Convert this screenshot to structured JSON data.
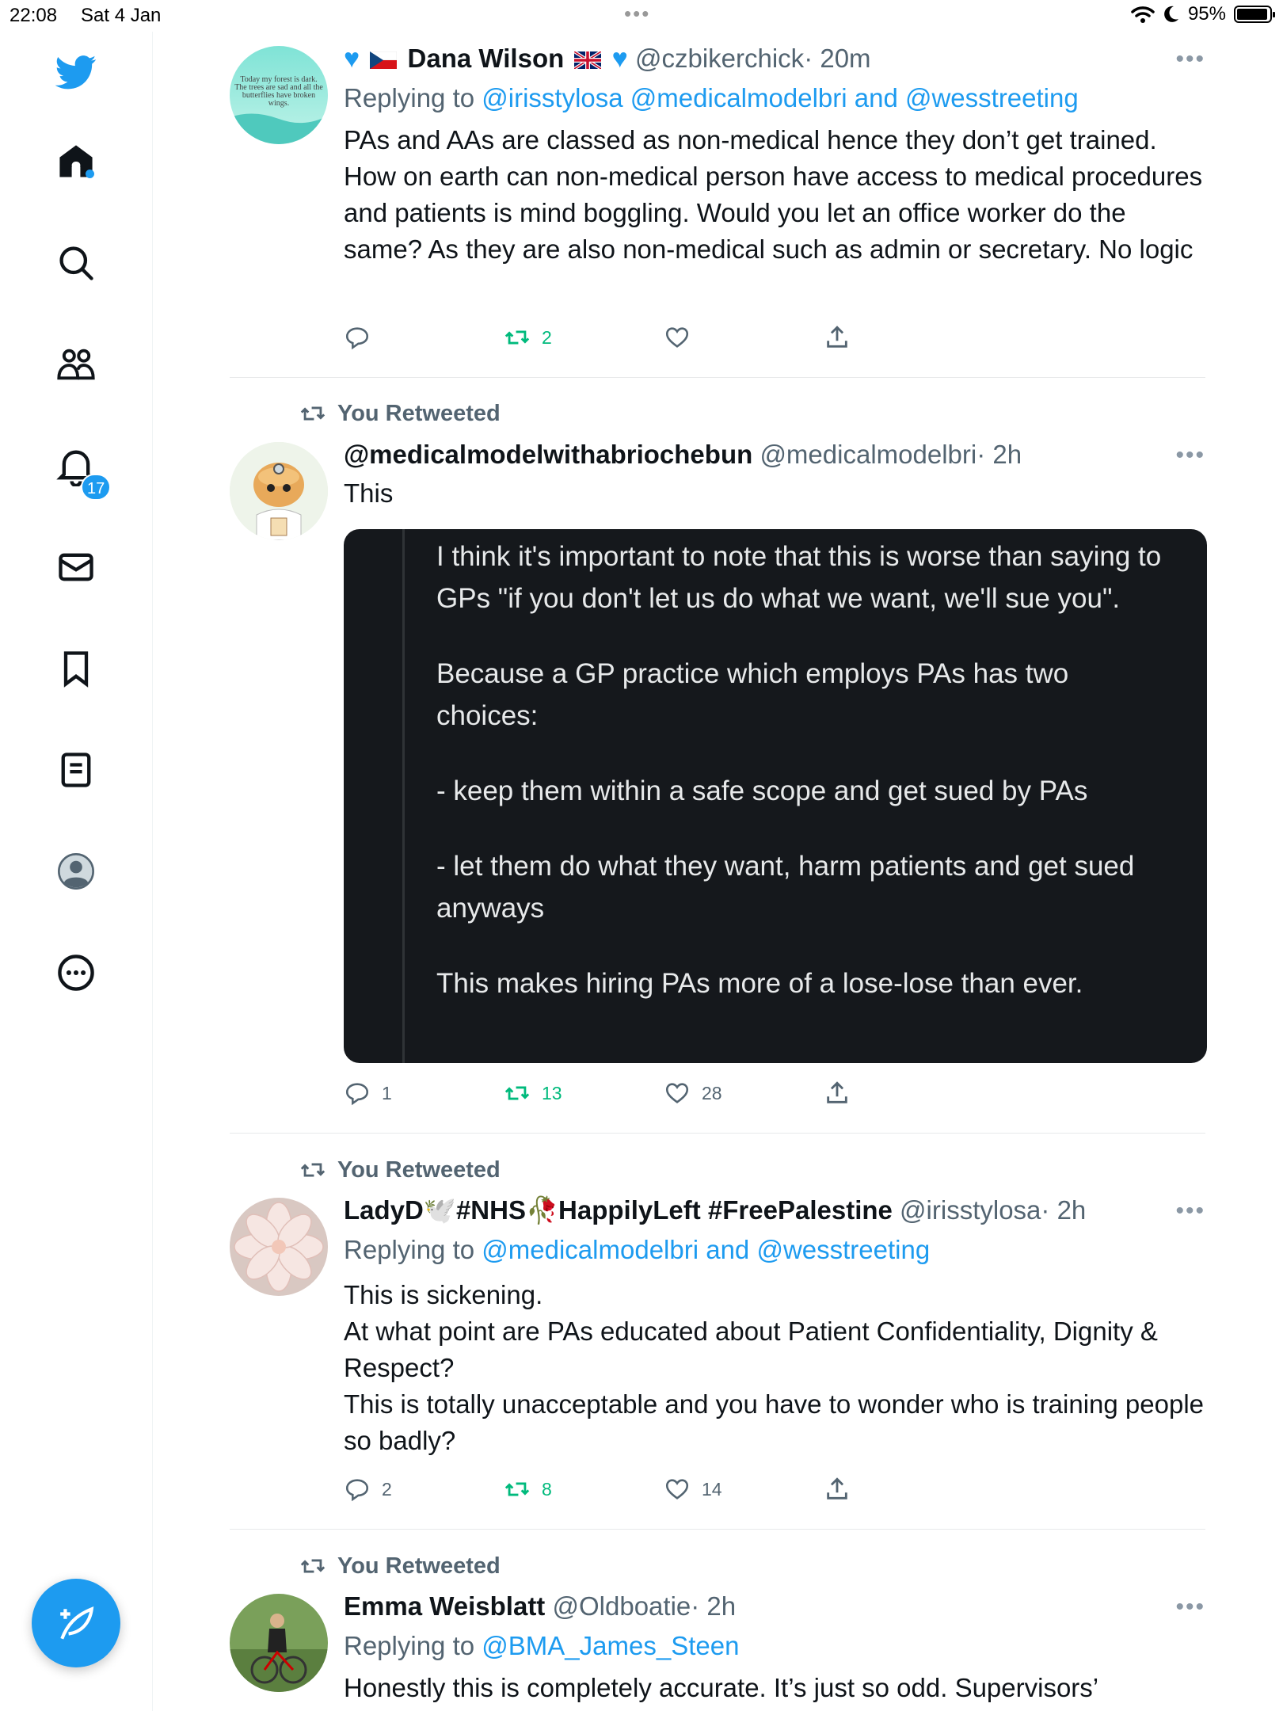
{
  "status_bar": {
    "time": "22:08",
    "date": "Sat 4 Jan",
    "battery": "95%"
  },
  "sidebar": {
    "notifications_badge": "17"
  },
  "avatars": {
    "dana_avatar_caption": "Today my forest is dark. The trees are sad and all the butterflies have broken wings."
  },
  "tweets": [
    {
      "name": "Dana Wilson",
      "handle": "@czbikerchick",
      "time": "· 20m",
      "replying_prefix": "Replying to",
      "replying_links": "@irisstylosa @medicalmodelbri and @wesstreeting",
      "text": "PAs and AAs are classed as non-medical hence they don’t get trained. How on earth can non-medical person have access to medical procedures and patients is mind boggling. Would you let an office worker do the same? As they are also non-medical  such as admin or secretary. No logic",
      "replies": "",
      "retweets": "2",
      "likes": ""
    },
    {
      "retweeted_label": "You Retweeted",
      "name": "@medicalmodelwithabriochebun",
      "handle": "@medicalmodelbri",
      "time": "· 2h",
      "text": "This",
      "quote": [
        "I think it's important to note that this is worse than saying to GPs \"if you don't let us do what we want, we'll sue you\".",
        "Because a GP practice which employs PAs has two choices:",
        "- keep them within a safe scope and get sued by PAs",
        "- let them do what they want, harm patients and get sued anyways",
        "This makes hiring PAs more of a lose-lose than ever."
      ],
      "replies": "1",
      "retweets": "13",
      "likes": "28"
    },
    {
      "retweeted_label": "You Retweeted",
      "name": "LadyD🕊️#NHS🥀HappilyLeft #FreePalestine",
      "handle": "@irisstylosa",
      "time": "· 2h",
      "replying_prefix": "Replying to",
      "replying_links": "@medicalmodelbri and @wesstreeting",
      "text_lines": [
        "This is sickening.",
        "At what point are PAs educated about Patient Confidentiality, Dignity & Respect?",
        "This is totally unacceptable and you have to wonder who is training people so badly?"
      ],
      "replies": "2",
      "retweets": "8",
      "likes": "14"
    },
    {
      "retweeted_label": "You Retweeted",
      "name": "Emma Weisblatt",
      "handle": "@Oldboatie",
      "time": "· 2h",
      "replying_prefix": "Replying to",
      "replying_links": "@BMA_James_Steen",
      "text": "Honestly this is completely accurate. It’s just so odd. Supervisors’"
    }
  ]
}
